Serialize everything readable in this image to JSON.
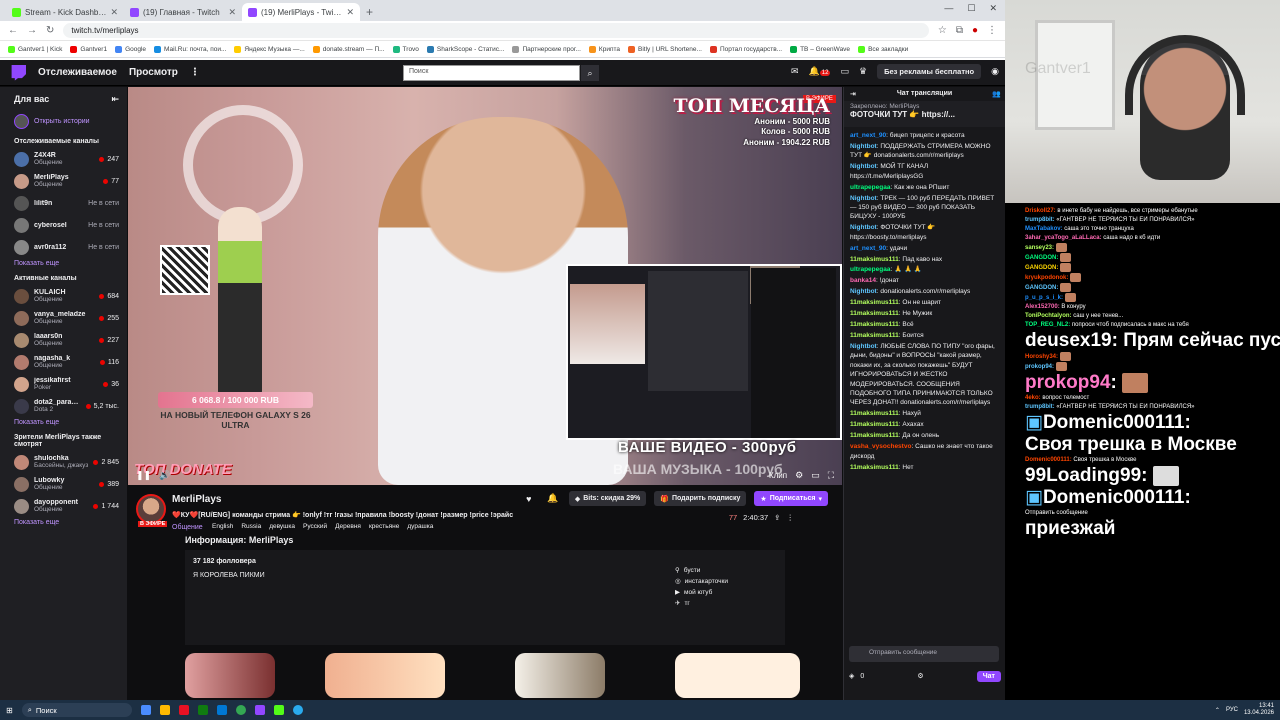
{
  "browser": {
    "tabs": [
      {
        "title": "Stream - Kick Dashboard",
        "color": "#53fc18"
      },
      {
        "title": "(19) Главная - Twitch",
        "color": "#9147ff"
      },
      {
        "title": "(19) MerliPlays - Twitch",
        "color": "#9147ff"
      }
    ],
    "url": "twitch.tv/merliplays",
    "bookmarks": [
      "Gantver1 | Kick",
      "Gantver1",
      "Google",
      "Mail.Ru: почта, пои...",
      "Яндекс Музыка —...",
      "donate.stream — П...",
      "Trovo",
      "SharkScope - Статис...",
      "Партнерские прог...",
      "Крипта",
      "Bitly | URL Shortene...",
      "Портал государств...",
      "TB – GreenWave",
      "Все закладки"
    ]
  },
  "nav": {
    "following": "Отслеживаемое",
    "browse": "Просмотр",
    "more": "⋮",
    "search_placeholder": "Поиск",
    "notif_count": "12",
    "no_ads": "Без рекламы бесплатно"
  },
  "sidebar": {
    "for_you": "Для вас",
    "open_history": "Открыть истории",
    "followed_title": "Отслеживаемые каналы",
    "followed": [
      {
        "name": "Z4X4R",
        "cat": "Общение",
        "viewers": "247",
        "live": true,
        "color": "#4b6fa8"
      },
      {
        "name": "MerliPlays",
        "cat": "Общение",
        "viewers": "77",
        "live": true,
        "color": "#c69a88"
      },
      {
        "name": "lilit9n",
        "cat": "",
        "viewers": "Не в сети",
        "live": false,
        "color": "#555"
      },
      {
        "name": "cyberosel",
        "cat": "",
        "viewers": "Не в сети",
        "live": false,
        "color": "#777"
      },
      {
        "name": "avr0ra112",
        "cat": "",
        "viewers": "Не в сети",
        "live": false,
        "color": "#888"
      }
    ],
    "show_more": "Показать еще",
    "active_title": "Активные каналы",
    "active": [
      {
        "name": "KULAICH",
        "cat": "Общение",
        "viewers": "684",
        "color": "#6a4e3e"
      },
      {
        "name": "vanya_meladze",
        "cat": "Общение",
        "viewers": "255",
        "color": "#8e6b5a"
      },
      {
        "name": "laaars0n",
        "cat": "Общение",
        "viewers": "227",
        "color": "#a88a70"
      },
      {
        "name": "nagasha_k",
        "cat": "Общение",
        "viewers": "116",
        "color": "#b27b6e"
      },
      {
        "name": "jessikafirst",
        "cat": "Poker",
        "viewers": "36",
        "color": "#d2a48c"
      },
      {
        "name": "dota2_paragon_ru",
        "cat": "Dota 2",
        "viewers": "5,2 тыс.",
        "color": "#3a3a4a"
      }
    ],
    "show_more2": "Показать еще",
    "viewers_title": "Зрители MerliPlays также смотрят",
    "also": [
      {
        "name": "shulochka",
        "cat": "Бассейны, джакузи и п...",
        "viewers": "2 845",
        "color": "#c08878"
      },
      {
        "name": "Lubowky",
        "cat": "Общение",
        "viewers": "389",
        "color": "#8a6f64"
      },
      {
        "name": "dayopponent",
        "cat": "Общение",
        "viewers": "1 744",
        "color": "#9a8c84"
      }
    ],
    "show_more3": "Показать еще"
  },
  "video": {
    "top_month": "ТОП МЕСЯЦА",
    "live": "В ЭФИРЕ",
    "top_lines": [
      "Аноним - 5000 RUB",
      "Колов - 5000 RUB",
      "Аноним - 1904.22 RUB"
    ],
    "goal_amount": "6 068.8 / 100 000 RUB",
    "goal_label": "НА НОВЫЙ ТЕЛЕФОН GALAXY S 26 ULTRA",
    "qr_label": "DONATE",
    "your_video": "ВАШЕ ВИДЕО - 300руб",
    "your_music": "ВАША МУЗЫКА - 100руб",
    "top_donate": "ТОП DONATE",
    "clip": "Клип"
  },
  "stream": {
    "channel": "MerliPlays",
    "live": "В ЭФИРЕ",
    "title": "❤️КУ❤️[RU/ENG] команды стрима 👉 !onlyf !тг !газы !правила !boosty !донат !размер !price !эрайс",
    "category": "Общение",
    "tags": [
      "English",
      "Russia",
      "девушка",
      "Русский",
      "Деревня",
      "крестьяне",
      "дурашка"
    ],
    "bits_btn": "Bits: скидка 29%",
    "gift_btn": "Подарить подписку",
    "sub_btn": "Подписаться",
    "viewers": "77",
    "uptime": "2:40:37",
    "about_title": "Информация: MerliPlays",
    "followers": "37 182 фолловера",
    "bio": "Я КОРОЛЕВА ПИКМИ",
    "links": [
      "бусти",
      "инстакарточки",
      "мой ютуб",
      "тг"
    ]
  },
  "chat": {
    "header": "Чат трансляции",
    "pinned_label": "Закреплено: MerliPlays",
    "pinned_text": "ФОТОЧКИ ТУТ 👉 https://...",
    "messages": [
      {
        "user": "art_next_90",
        "color": "#1e90ff",
        "text": "бицеп трицепс и красота"
      },
      {
        "user": "Nightbot",
        "color": "#5ec6ff",
        "text": "ПОДДЕРЖАТЬ СТРИМЕРА МОЖНО ТУТ 👉 donationalerts.com/r/merliplays"
      },
      {
        "user": "Nightbot",
        "color": "#5ec6ff",
        "text": "МОЙ ТГ КАНАЛ https://t.me/MerliplaysGG"
      },
      {
        "user": "ultrapepegaa",
        "color": "#00ff7f",
        "text": "Как же она РПшит"
      },
      {
        "user": "Nightbot",
        "color": "#5ec6ff",
        "text": "ТРЕК — 100 руб ПЕРЕДАТЬ ПРИВЕТ — 150 руб ВИДЕО — 300 руб ПОКАЗАТЬ БИЦУХУ - 100РУБ"
      },
      {
        "user": "Nightbot",
        "color": "#5ec6ff",
        "text": "ФОТОЧКИ ТУТ 👉 https://boosty.to/merliplays"
      },
      {
        "user": "art_next_90",
        "color": "#1e90ff",
        "text": "удачи"
      },
      {
        "user": "11maksimus111",
        "color": "#b3ff5e",
        "text": "Пад каво нах"
      },
      {
        "user": "ultrapepegaa",
        "color": "#00ff7f",
        "text": "🙏 🙏 🙏"
      },
      {
        "user": "banka14",
        "color": "#ff69b4",
        "text": "!донат"
      },
      {
        "user": "Nightbot",
        "color": "#5ec6ff",
        "text": "donationalerts.com/r/merliplays"
      },
      {
        "user": "11maksimus111",
        "color": "#b3ff5e",
        "text": "Он не шарит"
      },
      {
        "user": "11maksimus111",
        "color": "#b3ff5e",
        "text": "Не Мужик"
      },
      {
        "user": "11maksimus111",
        "color": "#b3ff5e",
        "text": "Всё"
      },
      {
        "user": "11maksimus111",
        "color": "#b3ff5e",
        "text": "Боится"
      },
      {
        "user": "Nightbot",
        "color": "#5ec6ff",
        "text": "ЛЮБЫЕ СЛОВА ПО ТИПУ \"ого фары, дыни, бидоны\" и ВОПРОСЫ \"какой размер, покажи их, за сколько покажешь\" БУДУТ ИГНОРИРОВАТЬСЯ И ЖЕСТКО МОДЕРИРОВАТЬСЯ. СООБЩЕНИЯ ПОДОБНОГО ТИПА ПРИНИМАЮТСЯ ТОЛЬКО ЧЕРЕЗ ДОНАТ!! donationalerts.com/r/merliplays"
      },
      {
        "user": "11maksimus111",
        "color": "#b3ff5e",
        "text": "Нахуй"
      },
      {
        "user": "11maksimus111",
        "color": "#b3ff5e",
        "text": "Ахахах"
      },
      {
        "user": "11maksimus111",
        "color": "#b3ff5e",
        "text": "Да он олень"
      },
      {
        "user": "vasha_vysochestvo",
        "color": "#ff4500",
        "text": "Сашко не знает что такое дискорд"
      },
      {
        "user": "11maksimus111",
        "color": "#b3ff5e",
        "text": "Нет"
      }
    ],
    "input_placeholder": "Отправить сообщение",
    "points": "0",
    "chat_btn": "Чат"
  },
  "webcam": {
    "watermark": "Gantver1"
  },
  "overlay_chat": {
    "small_top": [
      {
        "user": "Driskoll27:",
        "text": "в инете бабу не найдешь, все стримеры ебанутые"
      },
      {
        "user": "trump8bit:",
        "text": "«ГАНТВЕР НЕ ТЕРЯЙСЯ ТЫ ЕЙ ПОНРАВИЛСЯ»"
      },
      {
        "user": "MaxTabakov:",
        "text": "саша это точно транцуха"
      },
      {
        "user": "3ahar_ycaTogo_aLaLLaca:",
        "text": "саша надо в кб идти"
      },
      {
        "user": "sansey23:",
        "text": ""
      },
      {
        "user": "GANGDON:",
        "text": ""
      },
      {
        "user": "GANGDON:",
        "text": ""
      },
      {
        "user": "kryukpodonok:",
        "text": ""
      },
      {
        "user": "GANGDON:",
        "text": ""
      },
      {
        "user": "p_u_p_s_i_k:",
        "text": ""
      },
      {
        "user": "Alex152700:",
        "text": "В конуру"
      },
      {
        "user": "ToniPochtalyon:",
        "text": "саш у нее тенев..."
      },
      {
        "user": "TOP_REG_NL2:",
        "text": "попроси чтоб подписалась в макс на тебя"
      }
    ],
    "big1_user": "deusex19",
    "big1_text": ": Прям сейчас пусть выезжает",
    "mid1": [
      {
        "user": "Horoshy34:",
        "text": ""
      },
      {
        "user": "prokop94:",
        "text": ""
      }
    ],
    "big2_user": "prokop94",
    "big2_text": ":",
    "mid2": [
      {
        "user": "4eko:",
        "text": "вопрос телемост"
      },
      {
        "user": "trump8bit:",
        "text": "«ГАНТВЕР НЕ ТЕРЯЙСЯ ТЫ ЕЙ ПОНРАВИЛСЯ»"
      }
    ],
    "big3_user": "Domenic000111",
    "big3_text": ":",
    "big4_text": "Своя трешка в Москве",
    "mid3": [
      {
        "user": "Domenic000111:",
        "text": "Своя трешка в Москве"
      }
    ],
    "big5_user": "99Loading99",
    "big5_text": ":",
    "big6_user": "Domenic000111",
    "big6_text": ":",
    "big7_text": "приезжай",
    "footer_input": "Отправить сообщение"
  },
  "taskbar": {
    "search": "Поиск",
    "lang": "РУС",
    "time": "13:41",
    "date": "13.04.2026"
  }
}
